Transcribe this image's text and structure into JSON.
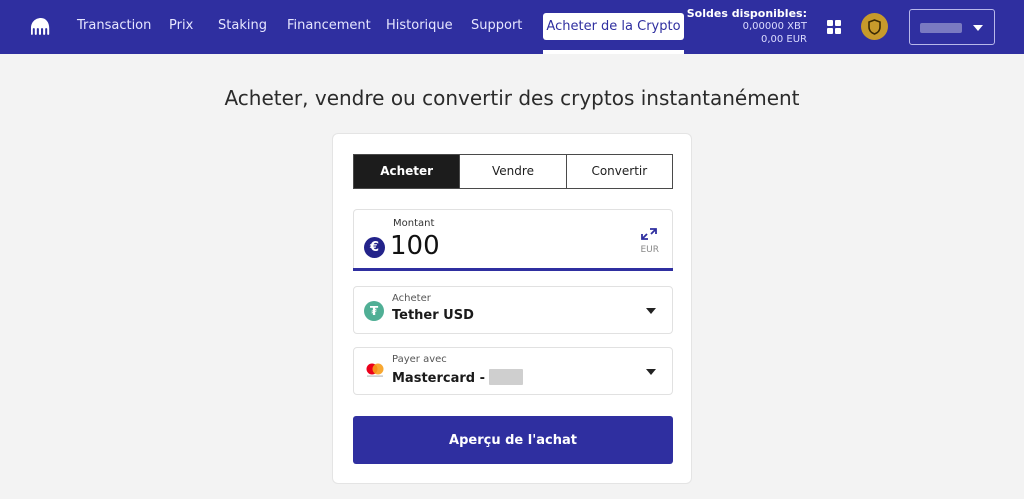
{
  "nav": {
    "items": [
      "Transaction",
      "Prix",
      "Staking",
      "Financement",
      "Historique",
      "Support"
    ],
    "active_tab": "Acheter de la Crypto"
  },
  "balances": {
    "title": "Soldes disponibles:",
    "lines": [
      "0,00000 XBT",
      "0,00 EUR"
    ]
  },
  "page": {
    "heading": "Acheter, vendre ou convertir des cryptos instantanément"
  },
  "form": {
    "tabs": [
      "Acheter",
      "Vendre",
      "Convertir"
    ],
    "active_tab": "Acheter",
    "amount": {
      "label": "Montant",
      "currency_symbol": "€",
      "value": "100",
      "unit": "EUR"
    },
    "asset": {
      "label": "Acheter",
      "value": "Tether USD",
      "icon_symbol": "₮"
    },
    "payment": {
      "label": "Payer avec",
      "value": "Mastercard -"
    },
    "submit_label": "Aperçu de l'achat"
  },
  "colors": {
    "brand": "#2f2fa0",
    "tether": "#50af95",
    "badge": "#c79a2b"
  }
}
